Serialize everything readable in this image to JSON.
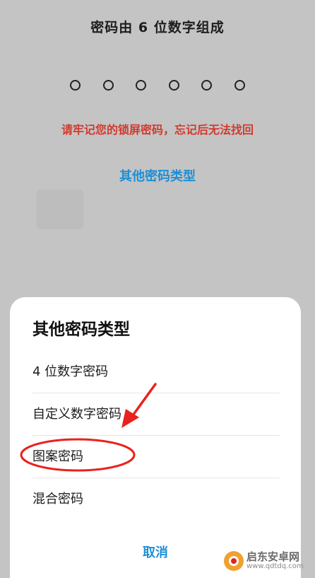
{
  "lockscreen": {
    "title": "密码由 6 位数字组成",
    "pin_length": 6,
    "warning": "请牢记您的锁屏密码，忘记后无法找回",
    "other_types_link": "其他密码类型"
  },
  "sheet": {
    "title": "其他密码类型",
    "options": [
      {
        "label": "4 位数字密码"
      },
      {
        "label": "自定义数字密码"
      },
      {
        "label": "图案密码"
      },
      {
        "label": "混合密码"
      }
    ],
    "cancel": "取消"
  },
  "annotation": {
    "highlight_color": "#e8221c",
    "highlighted_option": "图案密码"
  },
  "watermark": {
    "name": "启东安卓网",
    "url": "www.qdtdq.com"
  }
}
